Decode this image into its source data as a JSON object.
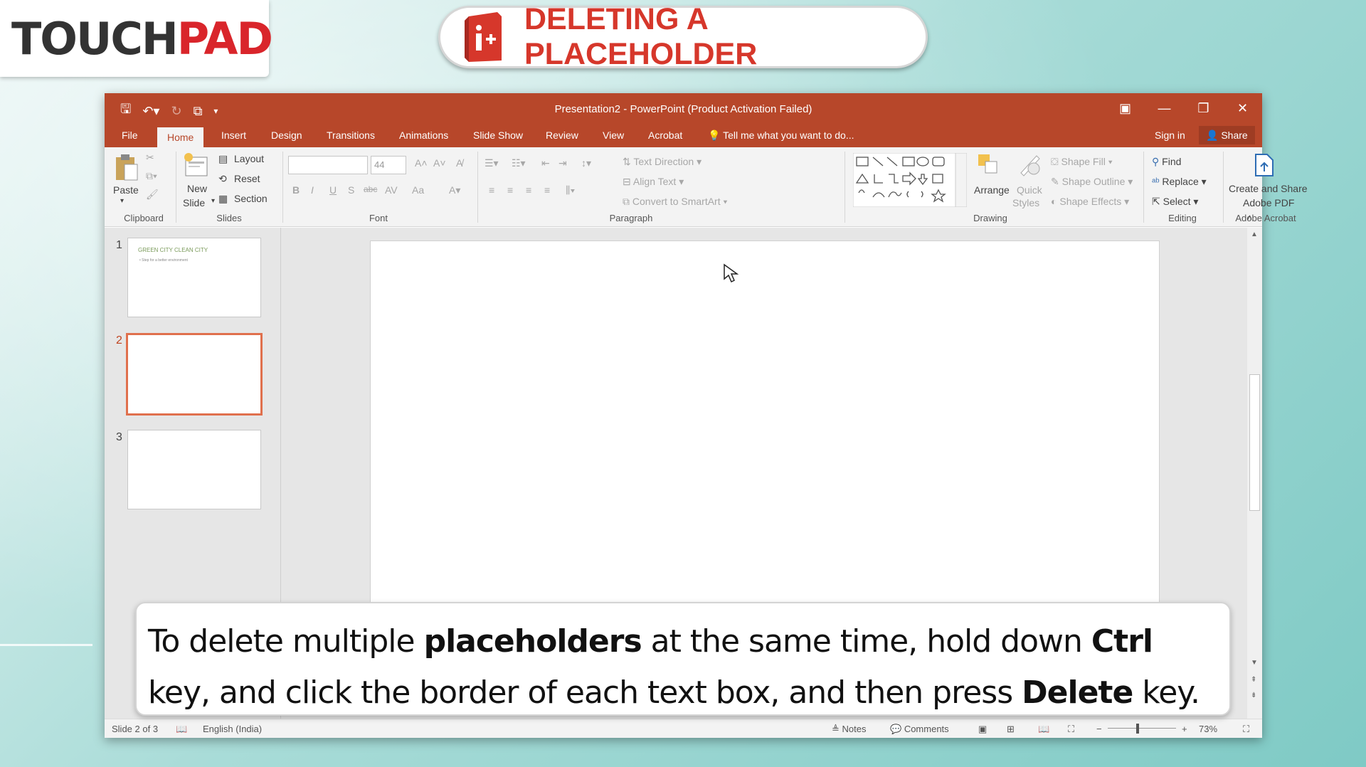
{
  "brand": {
    "logo_part1": "TOUCH",
    "logo_part2": "PAD"
  },
  "lesson_title": "DELETING A PLACEHOLDER",
  "window": {
    "title": "Presentation2 - PowerPoint (Product Activation Failed)",
    "accent": "#b7472a"
  },
  "tabs": [
    "File",
    "Home",
    "Insert",
    "Design",
    "Transitions",
    "Animations",
    "Slide Show",
    "Review",
    "View",
    "Acrobat"
  ],
  "tell_me": "Tell me what you want to do...",
  "sign_in": "Sign in",
  "share": "Share",
  "ribbon": {
    "clipboard": {
      "label": "Clipboard",
      "paste": "Paste"
    },
    "slides": {
      "label": "Slides",
      "new_slide_1": "New",
      "new_slide_2": "Slide",
      "layout": "Layout",
      "reset": "Reset",
      "section": "Section"
    },
    "font": {
      "label": "Font",
      "size": "44",
      "bold": "B",
      "italic": "I",
      "underline": "U",
      "shadow": "S",
      "strike": "abc",
      "spacing": "AV",
      "case": "Aa"
    },
    "paragraph": {
      "label": "Paragraph",
      "text_direction": "Text Direction",
      "align_text": "Align Text",
      "convert_smartart": "Convert to SmartArt"
    },
    "drawing": {
      "label": "Drawing",
      "arrange": "Arrange",
      "quick_styles_1": "Quick",
      "quick_styles_2": "Styles",
      "shape_fill": "Shape Fill",
      "shape_outline": "Shape Outline",
      "shape_effects": "Shape Effects"
    },
    "editing": {
      "label": "Editing",
      "find": "Find",
      "replace": "Replace",
      "select": "Select"
    },
    "acrobat": {
      "label": "Adobe Acrobat",
      "create_1": "Create and Share",
      "create_2": "Adobe PDF"
    }
  },
  "slides": [
    {
      "num": "1",
      "title": "GREEN CITY CLEAN CITY",
      "bullet": "• Step for a better environment"
    },
    {
      "num": "2"
    },
    {
      "num": "3"
    }
  ],
  "status": {
    "slide_info": "Slide 2 of 3",
    "language": "English (India)",
    "notes": "Notes",
    "comments": "Comments",
    "zoom": "73%"
  },
  "caption": {
    "p1": "To delete multiple ",
    "b1": "placeholders",
    "p2": " at the same time, hold down ",
    "b2": "Ctrl",
    "p3": " key, and click the border of each text box, and then press ",
    "b3": "Delete",
    "p4": " key."
  }
}
